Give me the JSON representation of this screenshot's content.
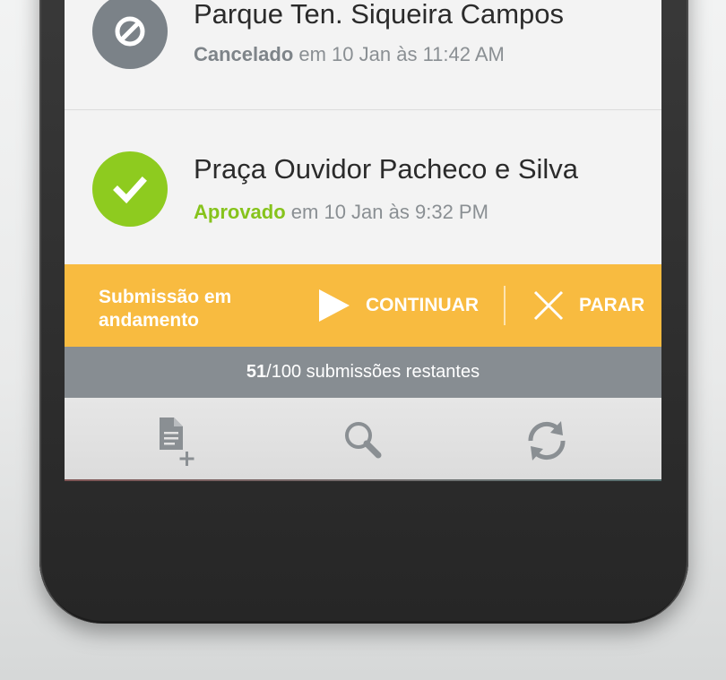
{
  "submissions": [
    {
      "title": "Parque Ten. Siqueira Campos",
      "status": "Cancelado",
      "detail": " em 10 Jan às 11:42 AM",
      "icon": "cancel-icon",
      "color": "#7b8288"
    },
    {
      "title": "Praça Ouvidor Pacheco e Silva",
      "status": "Aprovado",
      "detail": " em 10 Jan às 9:32 PM",
      "icon": "check-icon",
      "color": "#8ecb1f"
    }
  ],
  "banner": {
    "message": "Submissão em andamento",
    "continue_label": "CONTINUAR",
    "stop_label": "PARAR",
    "continue_icon": "play-icon",
    "stop_icon": "close-icon",
    "color": "#f8bb40"
  },
  "remaining": {
    "used": "51",
    "text": "/100 submissões restantes"
  },
  "toolbar": {
    "icons": [
      "new-document-icon",
      "search-icon",
      "sync-icon"
    ]
  }
}
